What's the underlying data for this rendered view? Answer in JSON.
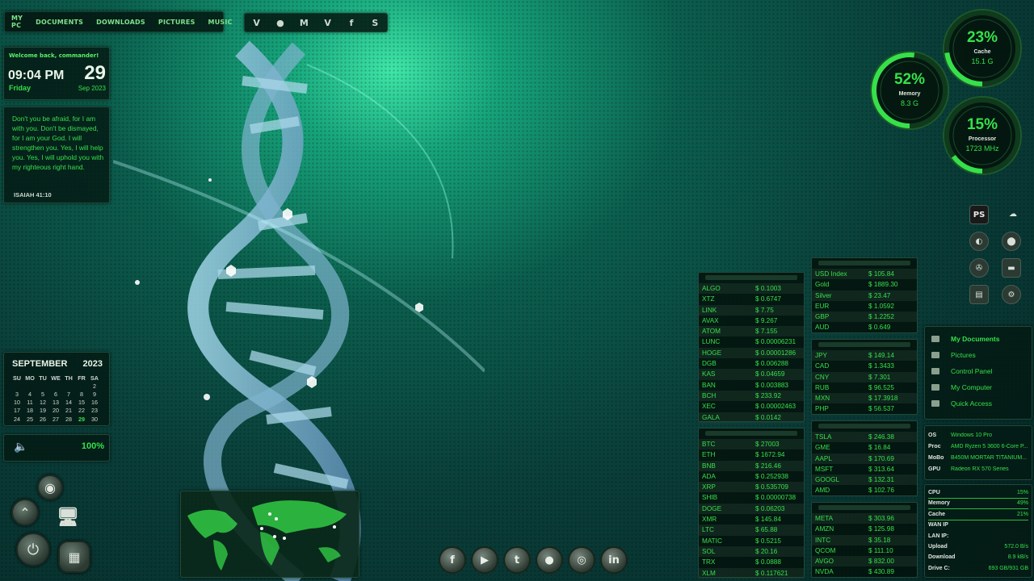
{
  "topnav": {
    "items": [
      "MY PC",
      "DOCUMENTS",
      "DOWNLOADS",
      "PICTURES",
      "MUSIC"
    ]
  },
  "social_top": {
    "icons": [
      "vimeo-icon",
      "reddit-icon",
      "gmail-icon",
      "vine-icon",
      "facebook-icon",
      "skype-icon"
    ],
    "glyphs": [
      "V",
      "●",
      "M",
      "V",
      "f",
      "S"
    ]
  },
  "clock": {
    "welcome": "Welcome back, commander!",
    "time": "09:04 PM",
    "day": "Friday",
    "date": "29",
    "month_year": "Sep 2023"
  },
  "verse": {
    "text": "Don't you be afraid, for I am with you. Don't be dismayed, for I am your God. I will strengthen you. Yes, I will help you. Yes, I will uphold you with my righteous right hand.",
    "reference": "ISAIAH 41:10"
  },
  "calendar": {
    "month": "SEPTEMBER",
    "year": "2023",
    "weekdays": [
      "SU",
      "MO",
      "TU",
      "WE",
      "TH",
      "FR",
      "SA"
    ],
    "weeks": [
      [
        "",
        "",
        "",
        "",
        "",
        "",
        "2"
      ],
      [
        "3",
        "4",
        "5",
        "6",
        "7",
        "8",
        "9"
      ],
      [
        "10",
        "11",
        "12",
        "13",
        "14",
        "15",
        "16"
      ],
      [
        "17",
        "18",
        "19",
        "20",
        "21",
        "22",
        "23"
      ],
      [
        "24",
        "25",
        "26",
        "27",
        "28",
        "29",
        "30"
      ]
    ],
    "today": "29"
  },
  "volume": {
    "level": "100%"
  },
  "gauges": [
    {
      "name": "cache",
      "percent": "23%",
      "label": "Cache",
      "value": "15.1 G",
      "fill": 0.23
    },
    {
      "name": "memory",
      "percent": "52%",
      "label": "Memory",
      "value": "8.3 G",
      "fill": 0.52
    },
    {
      "name": "processor",
      "percent": "15%",
      "label": "Processor",
      "value": "1723 MHz",
      "fill": 0.15
    }
  ],
  "crypto1": [
    {
      "sym": "ALGO",
      "val": "$ 0.1003"
    },
    {
      "sym": "XTZ",
      "val": "$ 0.6747"
    },
    {
      "sym": "LINK",
      "val": "$ 7.75"
    },
    {
      "sym": "AVAX",
      "val": "$ 9.267"
    },
    {
      "sym": "ATOM",
      "val": "$ 7.155"
    },
    {
      "sym": "LUNC",
      "val": "$ 0.00006231"
    },
    {
      "sym": "HOGE",
      "val": "$ 0.00001286"
    },
    {
      "sym": "DGB",
      "val": "$ 0.006288"
    },
    {
      "sym": "KAS",
      "val": "$ 0.04659"
    },
    {
      "sym": "BAN",
      "val": "$ 0.003883"
    },
    {
      "sym": "BCH",
      "val": "$ 233.92"
    },
    {
      "sym": "XEC",
      "val": "$ 0.00002463"
    },
    {
      "sym": "GALA",
      "val": "$ 0.0142"
    }
  ],
  "crypto2": [
    {
      "sym": "BTC",
      "val": "$ 27003"
    },
    {
      "sym": "ETH",
      "val": "$ 1672.94"
    },
    {
      "sym": "BNB",
      "val": "$ 216.46"
    },
    {
      "sym": "ADA",
      "val": "$ 0.252938"
    },
    {
      "sym": "XRP",
      "val": "$ 0.535709"
    },
    {
      "sym": "SHIB",
      "val": "$ 0.00000738"
    },
    {
      "sym": "DOGE",
      "val": "$ 0.06203"
    },
    {
      "sym": "XMR",
      "val": "$ 145.84"
    },
    {
      "sym": "LTC",
      "val": "$ 65.88"
    },
    {
      "sym": "MATIC",
      "val": "$ 0.5215"
    },
    {
      "sym": "SOL",
      "val": "$ 20.16"
    },
    {
      "sym": "TRX",
      "val": "$ 0.0888"
    },
    {
      "sym": "XLM",
      "val": "$ 0.117621"
    }
  ],
  "commodities": [
    {
      "sym": "USD Index",
      "val": "$ 105.84"
    },
    {
      "sym": "Gold",
      "val": "$ 1889.30"
    },
    {
      "sym": "Silver",
      "val": "$ 23.47"
    },
    {
      "sym": "EUR",
      "val": "$ 1.0592"
    },
    {
      "sym": "GBP",
      "val": "$ 1.2252"
    },
    {
      "sym": "AUD",
      "val": "$ 0.649"
    }
  ],
  "currencies": [
    {
      "sym": "JPY",
      "val": "$ 149.14"
    },
    {
      "sym": "CAD",
      "val": "$ 1.3433"
    },
    {
      "sym": "CNY",
      "val": "$ 7.301"
    },
    {
      "sym": "RUB",
      "val": "$ 96.525"
    },
    {
      "sym": "MXN",
      "val": "$ 17.3918"
    },
    {
      "sym": "PHP",
      "val": "$ 56.537"
    }
  ],
  "stocks1": [
    {
      "sym": "TSLA",
      "val": "$ 246.38"
    },
    {
      "sym": "GME",
      "val": "$ 16.84"
    },
    {
      "sym": "AAPL",
      "val": "$ 170.69"
    },
    {
      "sym": "MSFT",
      "val": "$ 313.64"
    },
    {
      "sym": "GOOGL",
      "val": "$ 132.31"
    },
    {
      "sym": "AMD",
      "val": "$ 102.76"
    }
  ],
  "stocks2": [
    {
      "sym": "META",
      "val": "$ 303.96"
    },
    {
      "sym": "AMZN",
      "val": "$ 125.98"
    },
    {
      "sym": "INTC",
      "val": "$ 35.18"
    },
    {
      "sym": "QCOM",
      "val": "$ 111.10"
    },
    {
      "sym": "AVGO",
      "val": "$ 832.00"
    },
    {
      "sym": "NVDA",
      "val": "$ 430.89"
    }
  ],
  "quick_links": [
    "My Documents",
    "Pictures",
    "Control Panel",
    "My Computer",
    "Quick Access"
  ],
  "sysinfo": [
    {
      "k": "OS",
      "v": "Windows 10 Pro"
    },
    {
      "k": "Proc",
      "v": "AMD Ryzen 5 3600 6-Core P..."
    },
    {
      "k": "MoBo",
      "v": "B450M MORTAR TITANIUM..."
    },
    {
      "k": "GPU",
      "v": "Radeon RX 570 Series"
    }
  ],
  "netinfo": [
    {
      "k": "CPU",
      "v": "15%"
    },
    {
      "k": "Memory",
      "v": "49%"
    },
    {
      "k": "Cache",
      "v": "21%"
    },
    {
      "k": "WAN IP",
      "v": ""
    },
    {
      "k": "LAN IP:",
      "v": ""
    },
    {
      "k": "Upload",
      "v": "572.0 B/s"
    },
    {
      "k": "Download",
      "v": "8.9 kB/s"
    },
    {
      "k": "Drive C:",
      "v": "693 GB/931 GB"
    }
  ],
  "bottom_social": {
    "icons": [
      "facebook-icon",
      "youtube-icon",
      "twitter-icon",
      "reddit-icon",
      "instagram-icon",
      "linkedin-icon"
    ],
    "glyphs": [
      "f",
      "▶",
      "t",
      "●",
      "◎",
      "in"
    ]
  },
  "app_icons": [
    "PS",
    "☁",
    "◐",
    "⬤",
    "✇",
    "▬",
    "▤",
    "⚙"
  ],
  "colors": {
    "accent": "#37e04a",
    "background": "#0a3f3a"
  }
}
